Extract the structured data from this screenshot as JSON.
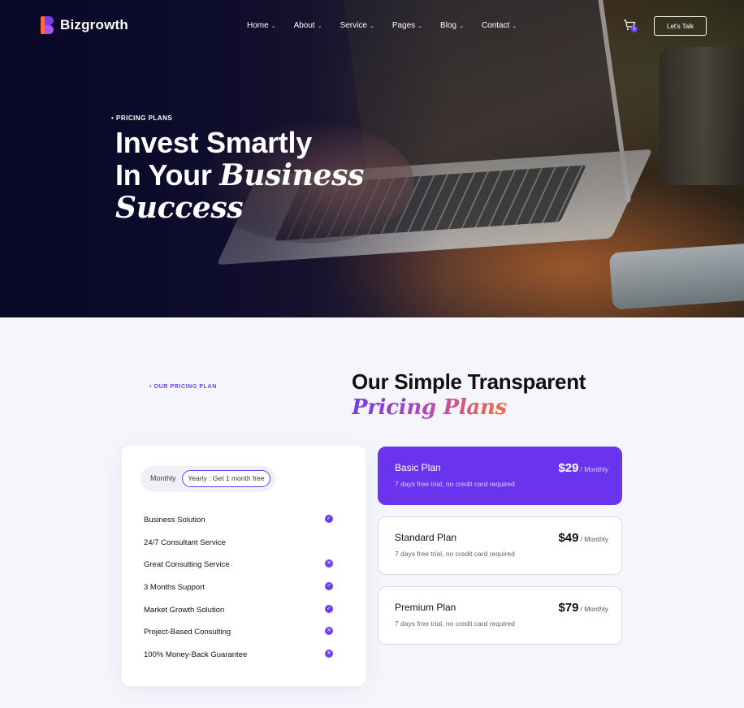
{
  "brand": {
    "name": "Bizgrowth"
  },
  "nav": [
    {
      "label": "Home"
    },
    {
      "label": "About"
    },
    {
      "label": "Service"
    },
    {
      "label": "Pages"
    },
    {
      "label": "Blog"
    },
    {
      "label": "Contact"
    }
  ],
  "header": {
    "cart_count": "0",
    "cta_label": "Let's Talk"
  },
  "hero": {
    "eyebrow": "• PRICING PLANS",
    "title_line1": "Invest Smartly",
    "title_line2_plain": "In Your ",
    "title_line2_italic": "Business",
    "title_line3_italic": "Success"
  },
  "pricing": {
    "eyebrow": "• OUR PRICING PLAN",
    "title_plain": "Our Simple Transparent",
    "title_italic": "Pricing Plans",
    "toggle": {
      "monthly": "Monthly",
      "yearly": "Yearly : Get 1 month free",
      "selected": "yearly"
    },
    "features": [
      {
        "label": "Business Solution",
        "mark": "check"
      },
      {
        "label": "24/7 Consultant Service",
        "mark": "none"
      },
      {
        "label": "Great Consulting Service",
        "mark": "cross"
      },
      {
        "label": "3 Months Support",
        "mark": "check"
      },
      {
        "label": "Market Growth Solution",
        "mark": "check"
      },
      {
        "label": "Project-Based Consulting",
        "mark": "cross"
      },
      {
        "label": "100% Money-Back Guarantee",
        "mark": "cross"
      }
    ],
    "plans": [
      {
        "name": "Basic Plan",
        "price": "$29",
        "per": "/ Monthly",
        "note": "7 days free trial, no credit card required",
        "active": true
      },
      {
        "name": "Standard Plan",
        "price": "$49",
        "per": "/ Monthly",
        "note": "7 days free trial, no credit card required",
        "active": false
      },
      {
        "name": "Premium Plan",
        "price": "$79",
        "per": "/ Monthly",
        "note": "7 days free trial, no credit card required",
        "active": false
      }
    ]
  },
  "colors": {
    "accent": "#6a34ef",
    "brand_orange": "#ff6a3d",
    "page_bg": "#f5f5fb"
  },
  "icons": {
    "cart": "cart-icon",
    "check": "check-circle-icon",
    "cross": "cross-circle-icon",
    "chevron": "chevron-down-icon"
  }
}
